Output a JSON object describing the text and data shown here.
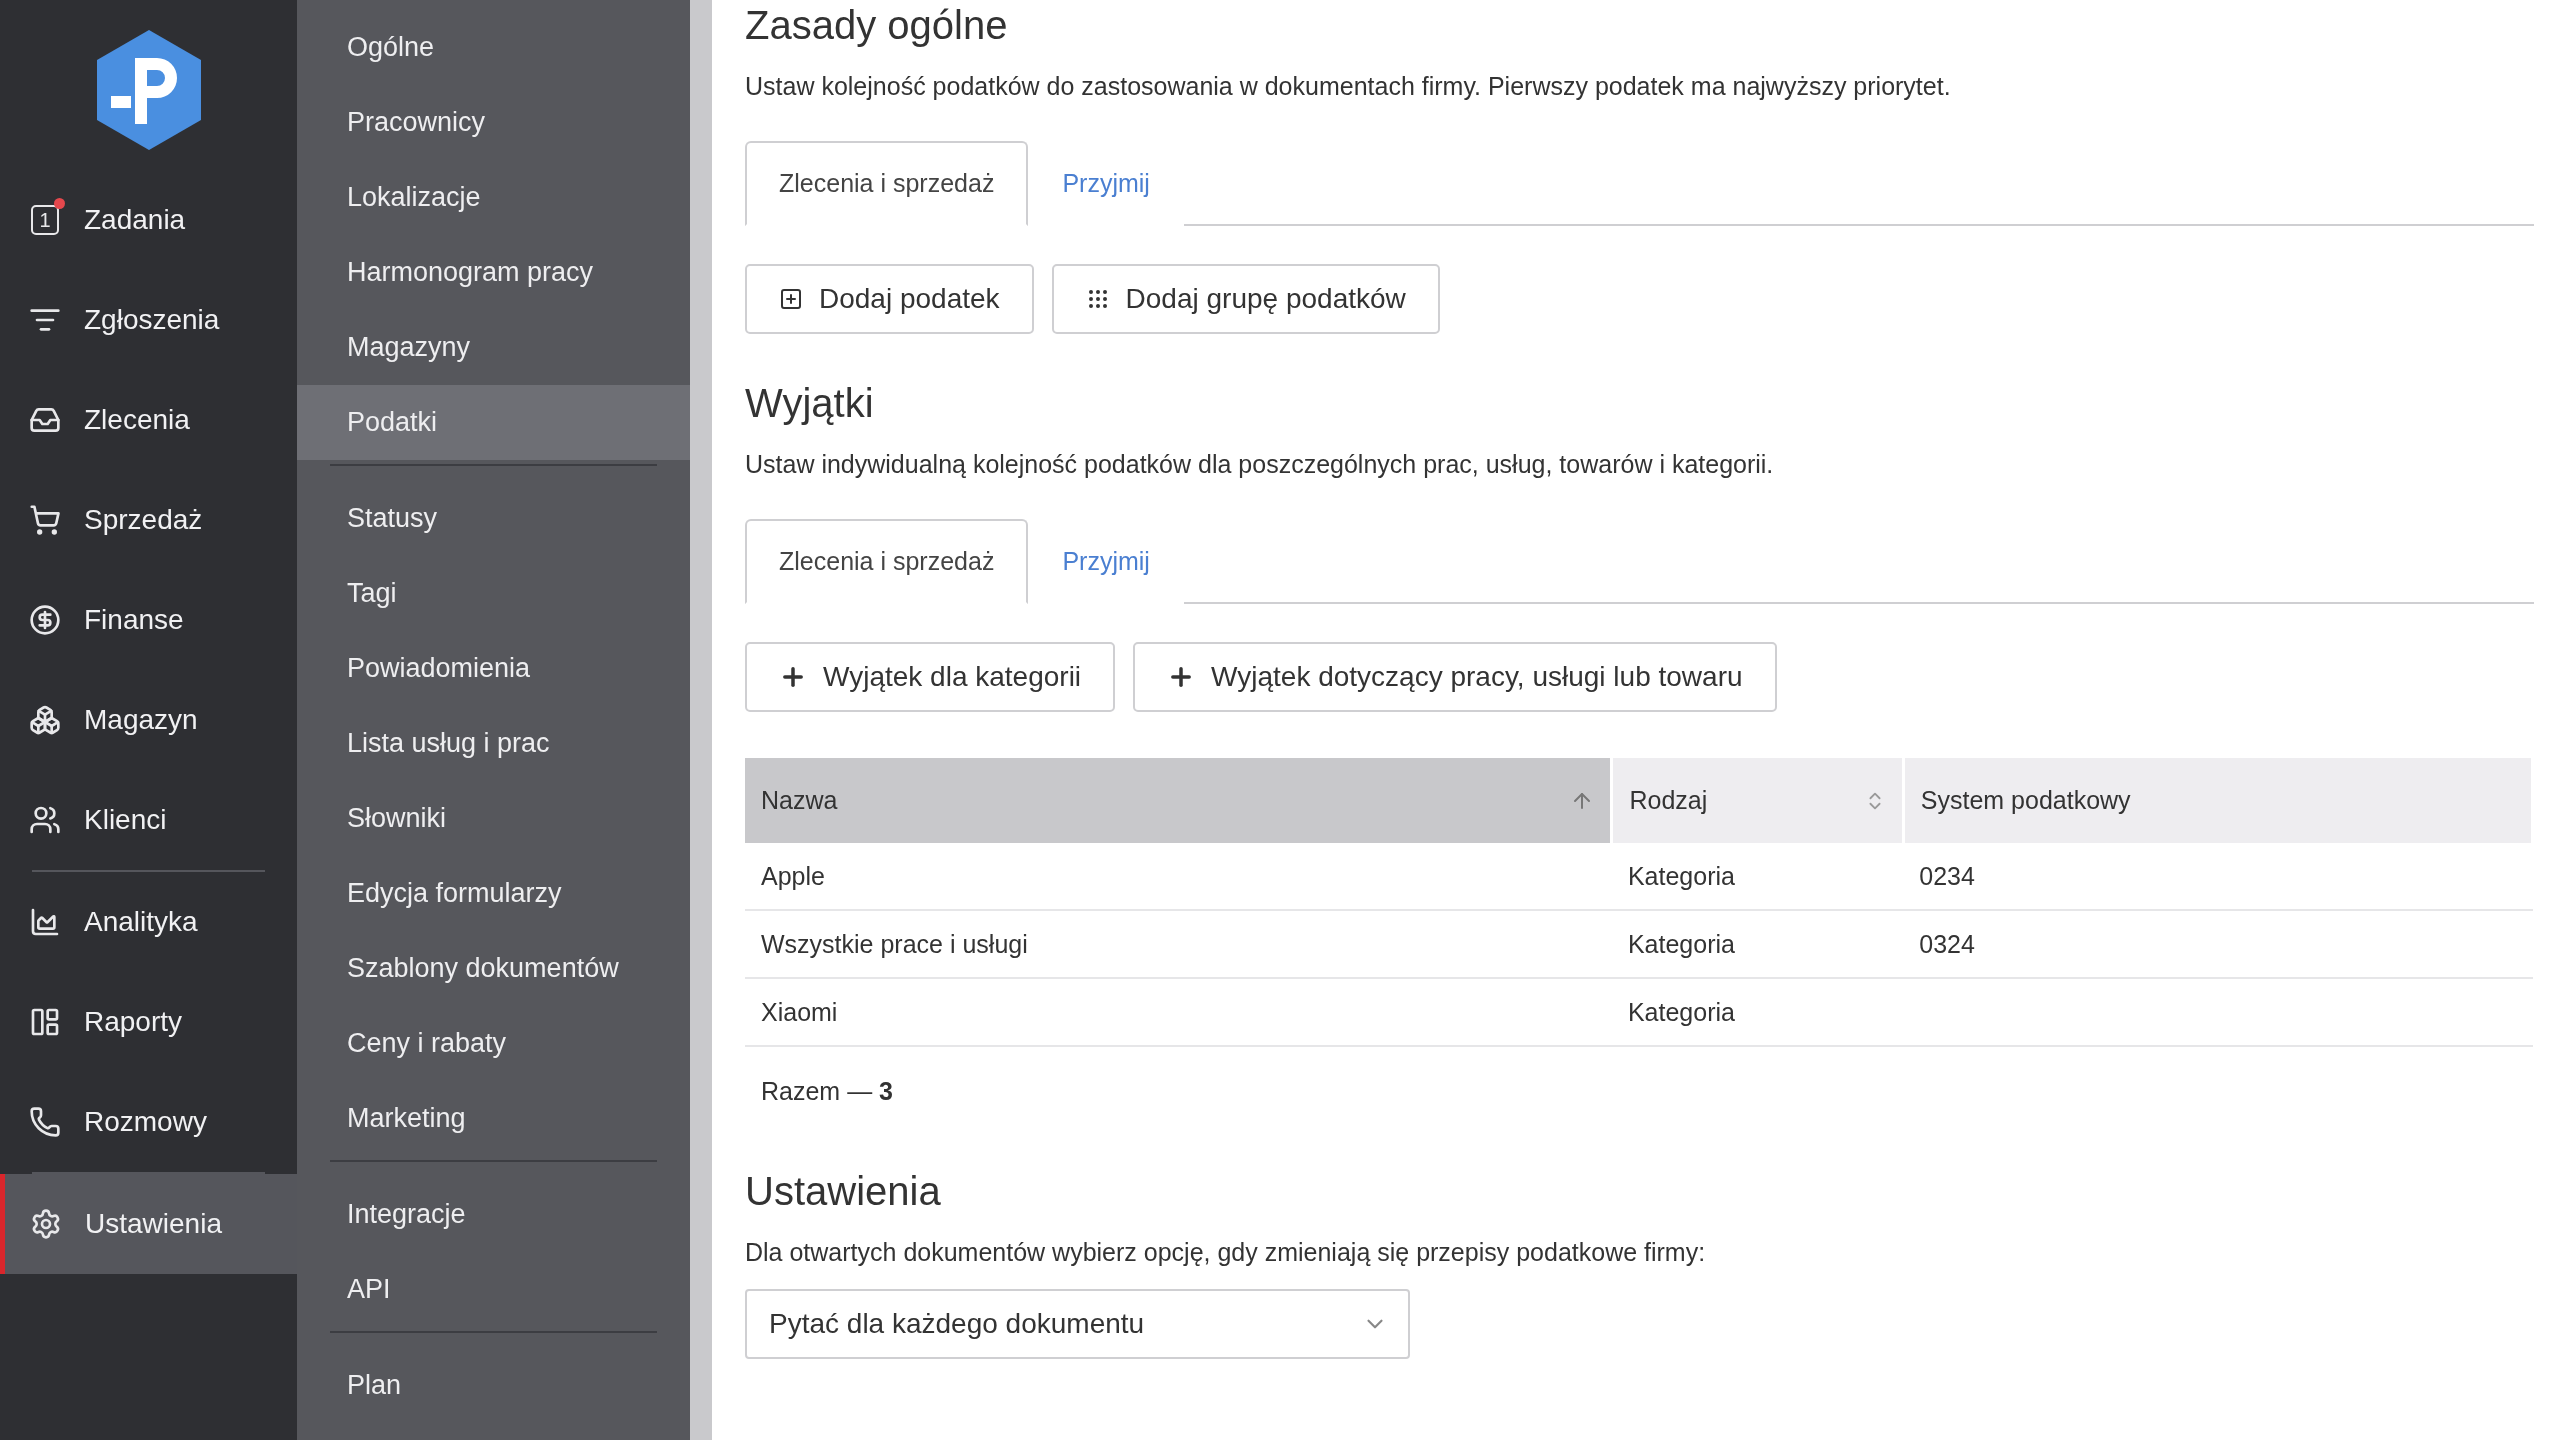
{
  "nav": {
    "groups": [
      [
        {
          "label": "Zadania",
          "counter": "1",
          "alert": true,
          "selected": false
        },
        {
          "label": "Zgłoszenia",
          "selected": false
        },
        {
          "label": "Zlecenia",
          "selected": false
        },
        {
          "label": "Sprzedaż",
          "selected": false
        },
        {
          "label": "Finanse",
          "selected": false
        },
        {
          "label": "Magazyn",
          "selected": false
        },
        {
          "label": "Klienci",
          "selected": false
        }
      ],
      [
        {
          "label": "Analityka",
          "selected": false
        },
        {
          "label": "Raporty",
          "selected": false
        },
        {
          "label": "Rozmowy",
          "selected": false
        }
      ],
      [
        {
          "label": "Ustawienia",
          "selected": true
        }
      ]
    ]
  },
  "settings_menu": {
    "groups": [
      [
        {
          "label": "Ogólne",
          "selected": false
        },
        {
          "label": "Pracownicy",
          "selected": false
        },
        {
          "label": "Lokalizacje",
          "selected": false
        },
        {
          "label": "Harmonogram pracy",
          "selected": false
        },
        {
          "label": "Magazyny",
          "selected": false
        },
        {
          "label": "Podatki",
          "selected": true
        }
      ],
      [
        {
          "label": "Statusy",
          "selected": false
        },
        {
          "label": "Tagi",
          "selected": false
        },
        {
          "label": "Powiadomienia",
          "selected": false
        },
        {
          "label": "Lista usług i prac",
          "selected": false
        },
        {
          "label": "Słowniki",
          "selected": false
        },
        {
          "label": "Edycja formularzy",
          "selected": false
        },
        {
          "label": "Szablony dokumentów",
          "selected": false
        },
        {
          "label": "Ceny i rabaty",
          "selected": false
        },
        {
          "label": "Marketing",
          "selected": false
        }
      ],
      [
        {
          "label": "Integracje",
          "selected": false
        },
        {
          "label": "API",
          "selected": false
        }
      ],
      [
        {
          "label": "Plan",
          "selected": false
        }
      ]
    ]
  },
  "general": {
    "title": "Zasady ogólne",
    "description": "Ustaw kolejność podatków do zastosowania w dokumentach firmy. Pierwszy podatek ma najwyższy priorytet.",
    "tabs": [
      {
        "label": "Zlecenia i sprzedaż",
        "selected": true
      },
      {
        "label": "Przyjmij",
        "selected": false
      }
    ],
    "buttons": [
      {
        "label": "Dodaj podatek",
        "kind": "add"
      },
      {
        "label": "Dodaj grupę podatków",
        "kind": "group"
      }
    ]
  },
  "exceptions": {
    "title": "Wyjątki",
    "description": "Ustaw indywidualną kolejność podatków dla poszczególnych prac, usług, towarów i kategorii.",
    "tabs": [
      {
        "label": "Zlecenia i sprzedaż",
        "selected": true
      },
      {
        "label": "Przyjmij",
        "selected": false
      }
    ],
    "buttons": [
      {
        "label": "Wyjątek dla kategorii",
        "kind": "plus"
      },
      {
        "label": "Wyjątek dotyczący pracy, usługi lub towaru",
        "kind": "plus"
      }
    ],
    "table": {
      "columns": [
        {
          "label": "Nazwa",
          "sorted": true,
          "sortable": true
        },
        {
          "label": "Rodzaj",
          "sorted": false,
          "sortable": true
        },
        {
          "label": "System podatkowy",
          "sorted": false,
          "sortable": false
        }
      ],
      "rows": [
        [
          "Apple",
          "Kategoria",
          "0234"
        ],
        [
          "Wszystkie prace i usługi",
          "Kategoria",
          "0324"
        ],
        [
          "Xiaomi",
          "Kategoria",
          ""
        ]
      ]
    },
    "total": "Razem — **3**"
  },
  "settings": {
    "title": "Ustawienia",
    "description": "Dla otwartych dokumentów wybierz opcję, gdy zmieniają się przepisy podatkowe firmy:",
    "select": {
      "value": "Pytać dla każdego dokumentu"
    }
  }
}
